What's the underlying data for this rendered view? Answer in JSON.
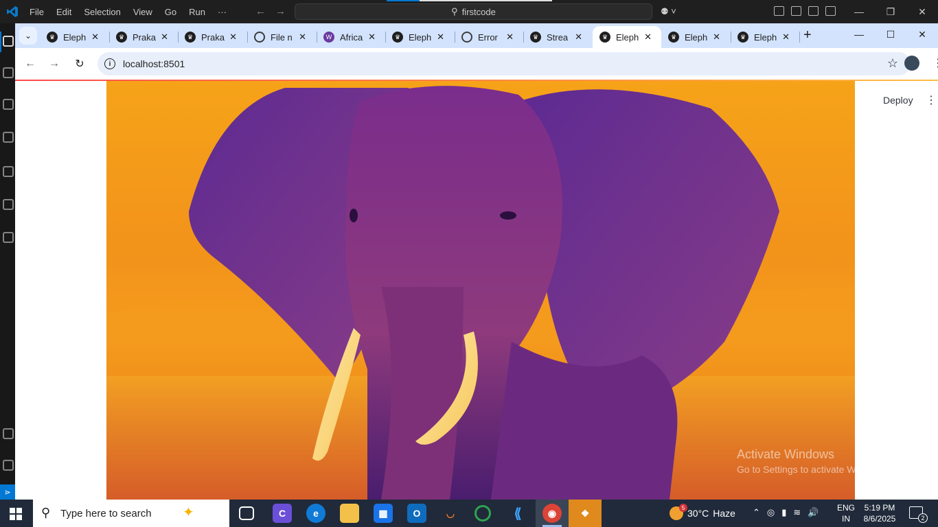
{
  "vscode": {
    "menu": [
      "File",
      "Edit",
      "Selection",
      "View",
      "Go",
      "Run",
      "···"
    ],
    "search_text": "firstcode",
    "window_controls": {
      "minimize": "—",
      "restore": "❐",
      "close": "✕"
    }
  },
  "chrome": {
    "tabs": [
      {
        "title": "Eleph",
        "icon": "streamlit-crown-icon"
      },
      {
        "title": "Praka",
        "icon": "streamlit-crown-icon"
      },
      {
        "title": "Praka",
        "icon": "streamlit-crown-icon"
      },
      {
        "title": "File n",
        "icon": "openai-icon"
      },
      {
        "title": "Africa",
        "icon": "wikipedia-icon"
      },
      {
        "title": "Eleph",
        "icon": "streamlit-crown-icon"
      },
      {
        "title": "Error",
        "icon": "openai-icon"
      },
      {
        "title": "Strea",
        "icon": "streamlit-crown-icon"
      },
      {
        "title": "Eleph",
        "icon": "streamlit-crown-icon",
        "active": true
      },
      {
        "title": "Eleph",
        "icon": "streamlit-crown-icon"
      },
      {
        "title": "Eleph",
        "icon": "streamlit-crown-icon"
      }
    ],
    "tab_close": "✕",
    "new_tab": "+",
    "url": "localhost:8501"
  },
  "page": {
    "deploy_label": "Deploy",
    "image_alt": "Elephant image with inferno colormap",
    "colors": {
      "background": "#f6a319",
      "elephant": "#6a2a8a",
      "tusk": "#fde9a8"
    }
  },
  "watermark": {
    "line1": "Activate Windows",
    "line2": "Go to Settings to activate Windows."
  },
  "taskbar": {
    "search_placeholder": "Type here to search",
    "weather": {
      "temp": "30°C",
      "condition": "Haze",
      "badge": "5"
    },
    "language": {
      "line1": "ENG",
      "line2": "IN"
    },
    "clock": {
      "time": "5:19 PM",
      "date": "8/6/2025"
    },
    "notifications": "2"
  }
}
